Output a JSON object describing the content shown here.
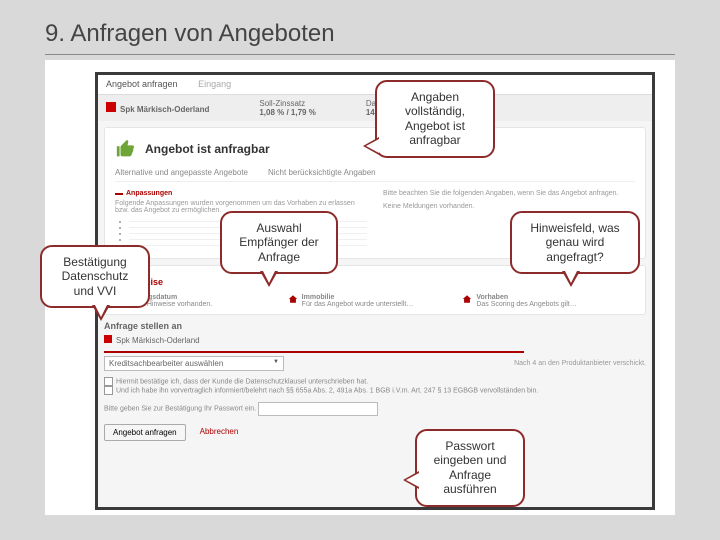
{
  "slide": {
    "title": "9. Anfragen von Angeboten"
  },
  "screenshot": {
    "tab": "Angebot anfragen",
    "breadcrumb": "Eingang",
    "header": {
      "bank": "Spk Märkisch-Oderland",
      "col2_label": "Soll-Zinssatz",
      "col2_value": "1,08 % / 1,79 %",
      "col3_label": "Darlehenssumme",
      "col3_value": "140.000,00 €"
    },
    "panel": {
      "title": "Angebot ist anfragbar",
      "sub1": "Alternative und angepasste Angebote",
      "sub2": "Nicht berücksichtigte Angaben",
      "leftHead": "Anpassungen",
      "leftText": "Folgende Anpassungen wurden vorgenommen um das Vorhaben zu erlassen bzw. das Angebot zu ermöglichen.",
      "rightHead": "",
      "rightText1": "Bitte beachten Sie die folgenden Angaben, wenn Sie das Angebot anfragen.",
      "rightText2": "Keine Meldungen vorhanden."
    },
    "hints": {
      "title": "Hinweise",
      "i1": {
        "head": "Auszugsdatum",
        "text": "Keine Hinweise vorhanden."
      },
      "i2": {
        "head": "Immobilie",
        "text": "Für das Angebot wurde unterstellt…"
      },
      "i3": {
        "head": "Vorhaben",
        "text": "Das Scoring des Angebots gilt…"
      }
    },
    "send": {
      "title": "Anfrage stellen an",
      "dropdown": "Kreditsachbearbeiter auswählen",
      "bankline": "Spk Märkisch-Oderland"
    },
    "right_note": "Nach 4 an den Produktanbieter verschickt.",
    "consent": {
      "line1": "Hiermit bestätige ich, dass der Kunde die Datenschutzklausel unterschrieben hat.",
      "line2": "Und ich habe ihn vorvertraglich informiert/belehrt nach §§ 655a Abs. 2, 491a Abs. 1 BGB i.V.m. Art. 247 § 13 EGBGB vervollständen bin."
    },
    "pwd_label": "Bitte geben Sie zur Bestätigung Ihr Passwort ein.",
    "buttons": {
      "submit": "Angebot anfragen",
      "cancel": "Abbrechen"
    }
  },
  "callouts": {
    "c1": "Angaben vollständig, Angebot ist anfragbar",
    "c2": "Auswahl Empfänger der Anfrage",
    "c3": "Hinweisfeld, was genau wird angefragt?",
    "c4": "Bestätigung Datenschutz und VVI",
    "c5": "Passwort eingeben und Anfrage ausführen"
  }
}
